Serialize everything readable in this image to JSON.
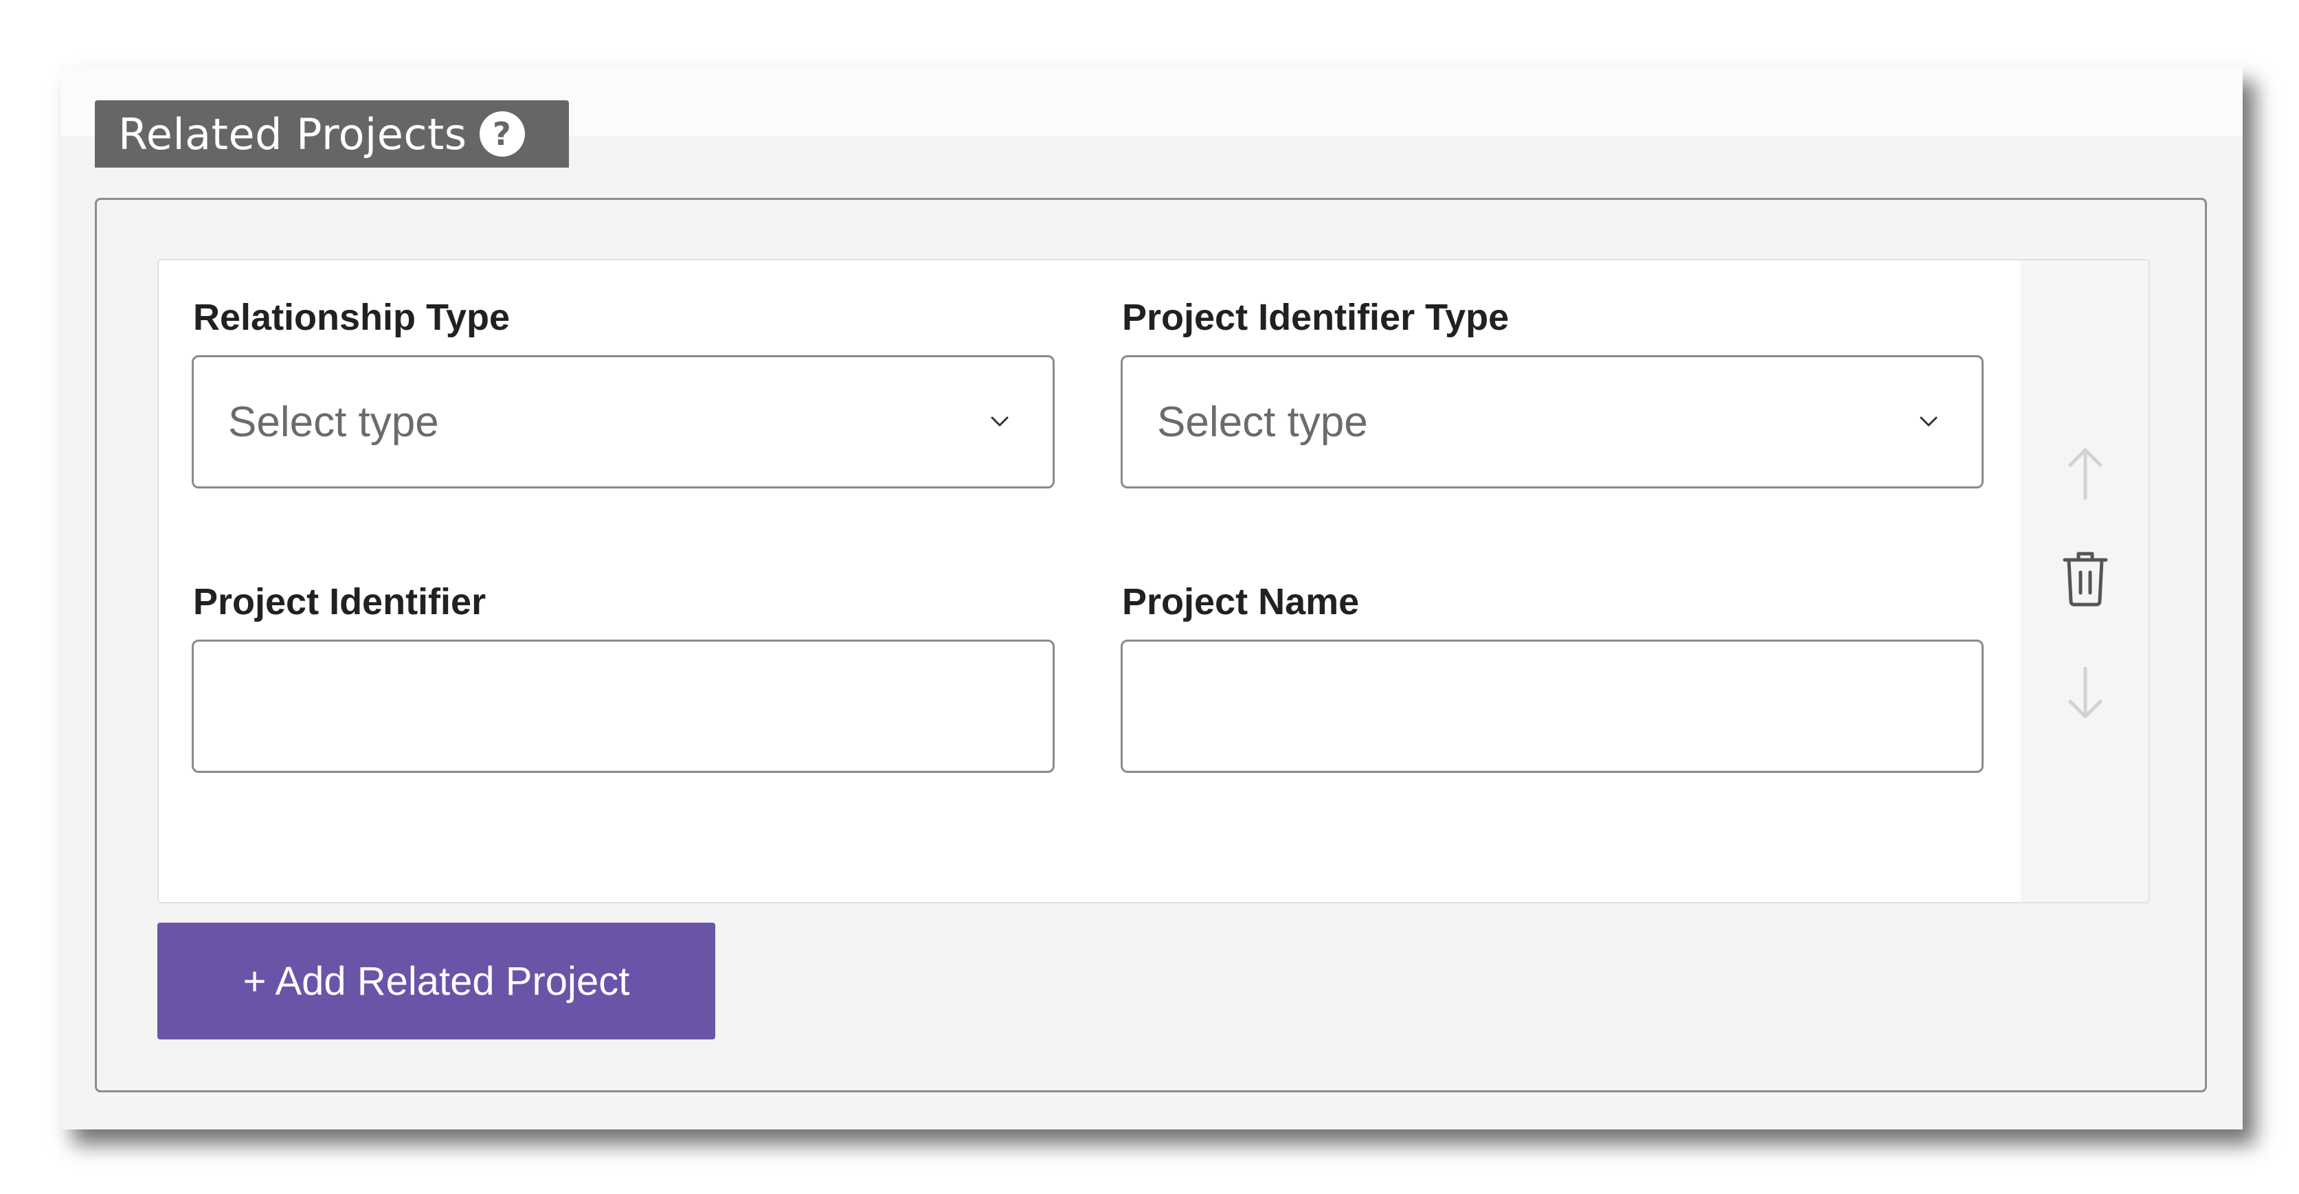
{
  "section": {
    "title": "Related Projects",
    "help_icon_glyph": "?"
  },
  "fields": {
    "relationship_type": {
      "label": "Relationship Type",
      "value": "Select type"
    },
    "project_identifier_type": {
      "label": "Project Identifier Type",
      "value": "Select type"
    },
    "project_identifier": {
      "label": "Project Identifier",
      "value": ""
    },
    "project_name": {
      "label": "Project Name",
      "value": ""
    }
  },
  "item_actions": {
    "icons": [
      "arrow-up-icon",
      "trash-icon",
      "arrow-down-icon"
    ]
  },
  "add_button": {
    "label": "+ Add Related Project"
  },
  "colors": {
    "header_bg": "#666666",
    "button_bg": "#6a54a8",
    "panel_bg": "#f4f4f4"
  }
}
